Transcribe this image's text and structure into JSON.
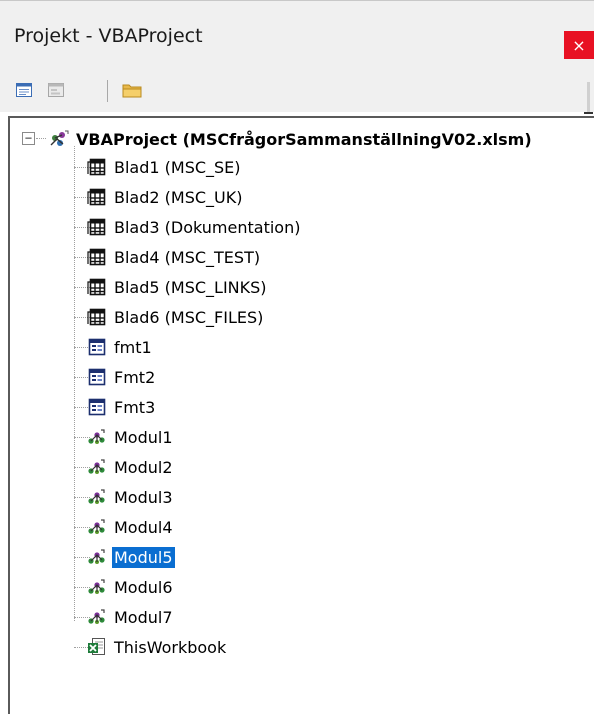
{
  "window": {
    "title": "Projekt - VBAProject",
    "close_glyph": "×",
    "close_color": "#e81123"
  },
  "toolbar": {
    "buttons": [
      {
        "name": "view-code-icon"
      },
      {
        "name": "view-object-icon"
      },
      {
        "name": "toggle-folders-icon"
      }
    ]
  },
  "tree": {
    "expander": "−",
    "root": {
      "label": "VBAProject (MSCfrågorSammanställningV02.xlsm)",
      "icon": "vba-project-icon"
    },
    "items": [
      {
        "label": "Blad1 (MSC_SE)",
        "icon": "worksheet-icon"
      },
      {
        "label": "Blad2 (MSC_UK)",
        "icon": "worksheet-icon"
      },
      {
        "label": "Blad3 (Dokumentation)",
        "icon": "worksheet-icon"
      },
      {
        "label": "Blad4 (MSC_TEST)",
        "icon": "worksheet-icon"
      },
      {
        "label": "Blad5 (MSC_LINKS)",
        "icon": "worksheet-icon"
      },
      {
        "label": "Blad6 (MSC_FILES)",
        "icon": "worksheet-icon"
      },
      {
        "label": "fmt1",
        "icon": "userform-icon"
      },
      {
        "label": "Fmt2",
        "icon": "userform-icon"
      },
      {
        "label": "Fmt3",
        "icon": "userform-icon"
      },
      {
        "label": "Modul1",
        "icon": "module-icon"
      },
      {
        "label": "Modul2",
        "icon": "module-icon"
      },
      {
        "label": "Modul3",
        "icon": "module-icon"
      },
      {
        "label": "Modul4",
        "icon": "module-icon"
      },
      {
        "label": "Modul5",
        "icon": "module-icon",
        "selected": true
      },
      {
        "label": "Modul6",
        "icon": "module-icon"
      },
      {
        "label": "Modul7",
        "icon": "module-icon"
      },
      {
        "label": "ThisWorkbook",
        "icon": "workbook-icon"
      }
    ],
    "selected_color": "#0a6ed1"
  }
}
